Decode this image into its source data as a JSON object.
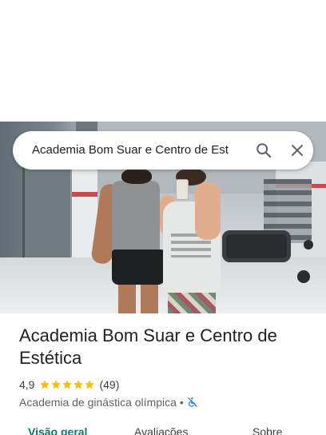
{
  "search": {
    "value": "Academia Bom Suar e Centro de Est",
    "search_icon": "search-icon",
    "close_icon": "close-icon"
  },
  "place": {
    "name": "Academia Bom Suar e Centro de Estética",
    "rating": "4,9",
    "stars": 5,
    "review_count": "(49)",
    "category": "Academia de ginástica olímpica",
    "separator": "•",
    "accessibility_icon": "not-wheelchair-accessible-icon"
  },
  "tabs": [
    {
      "label": "Visão geral",
      "active": true
    },
    {
      "label": "Avaliações",
      "active": false
    },
    {
      "label": "Sobre",
      "active": false
    }
  ],
  "colors": {
    "accent": "#0b7a6e",
    "star": "#fbbc04",
    "accessibility": "#1a73e8"
  }
}
